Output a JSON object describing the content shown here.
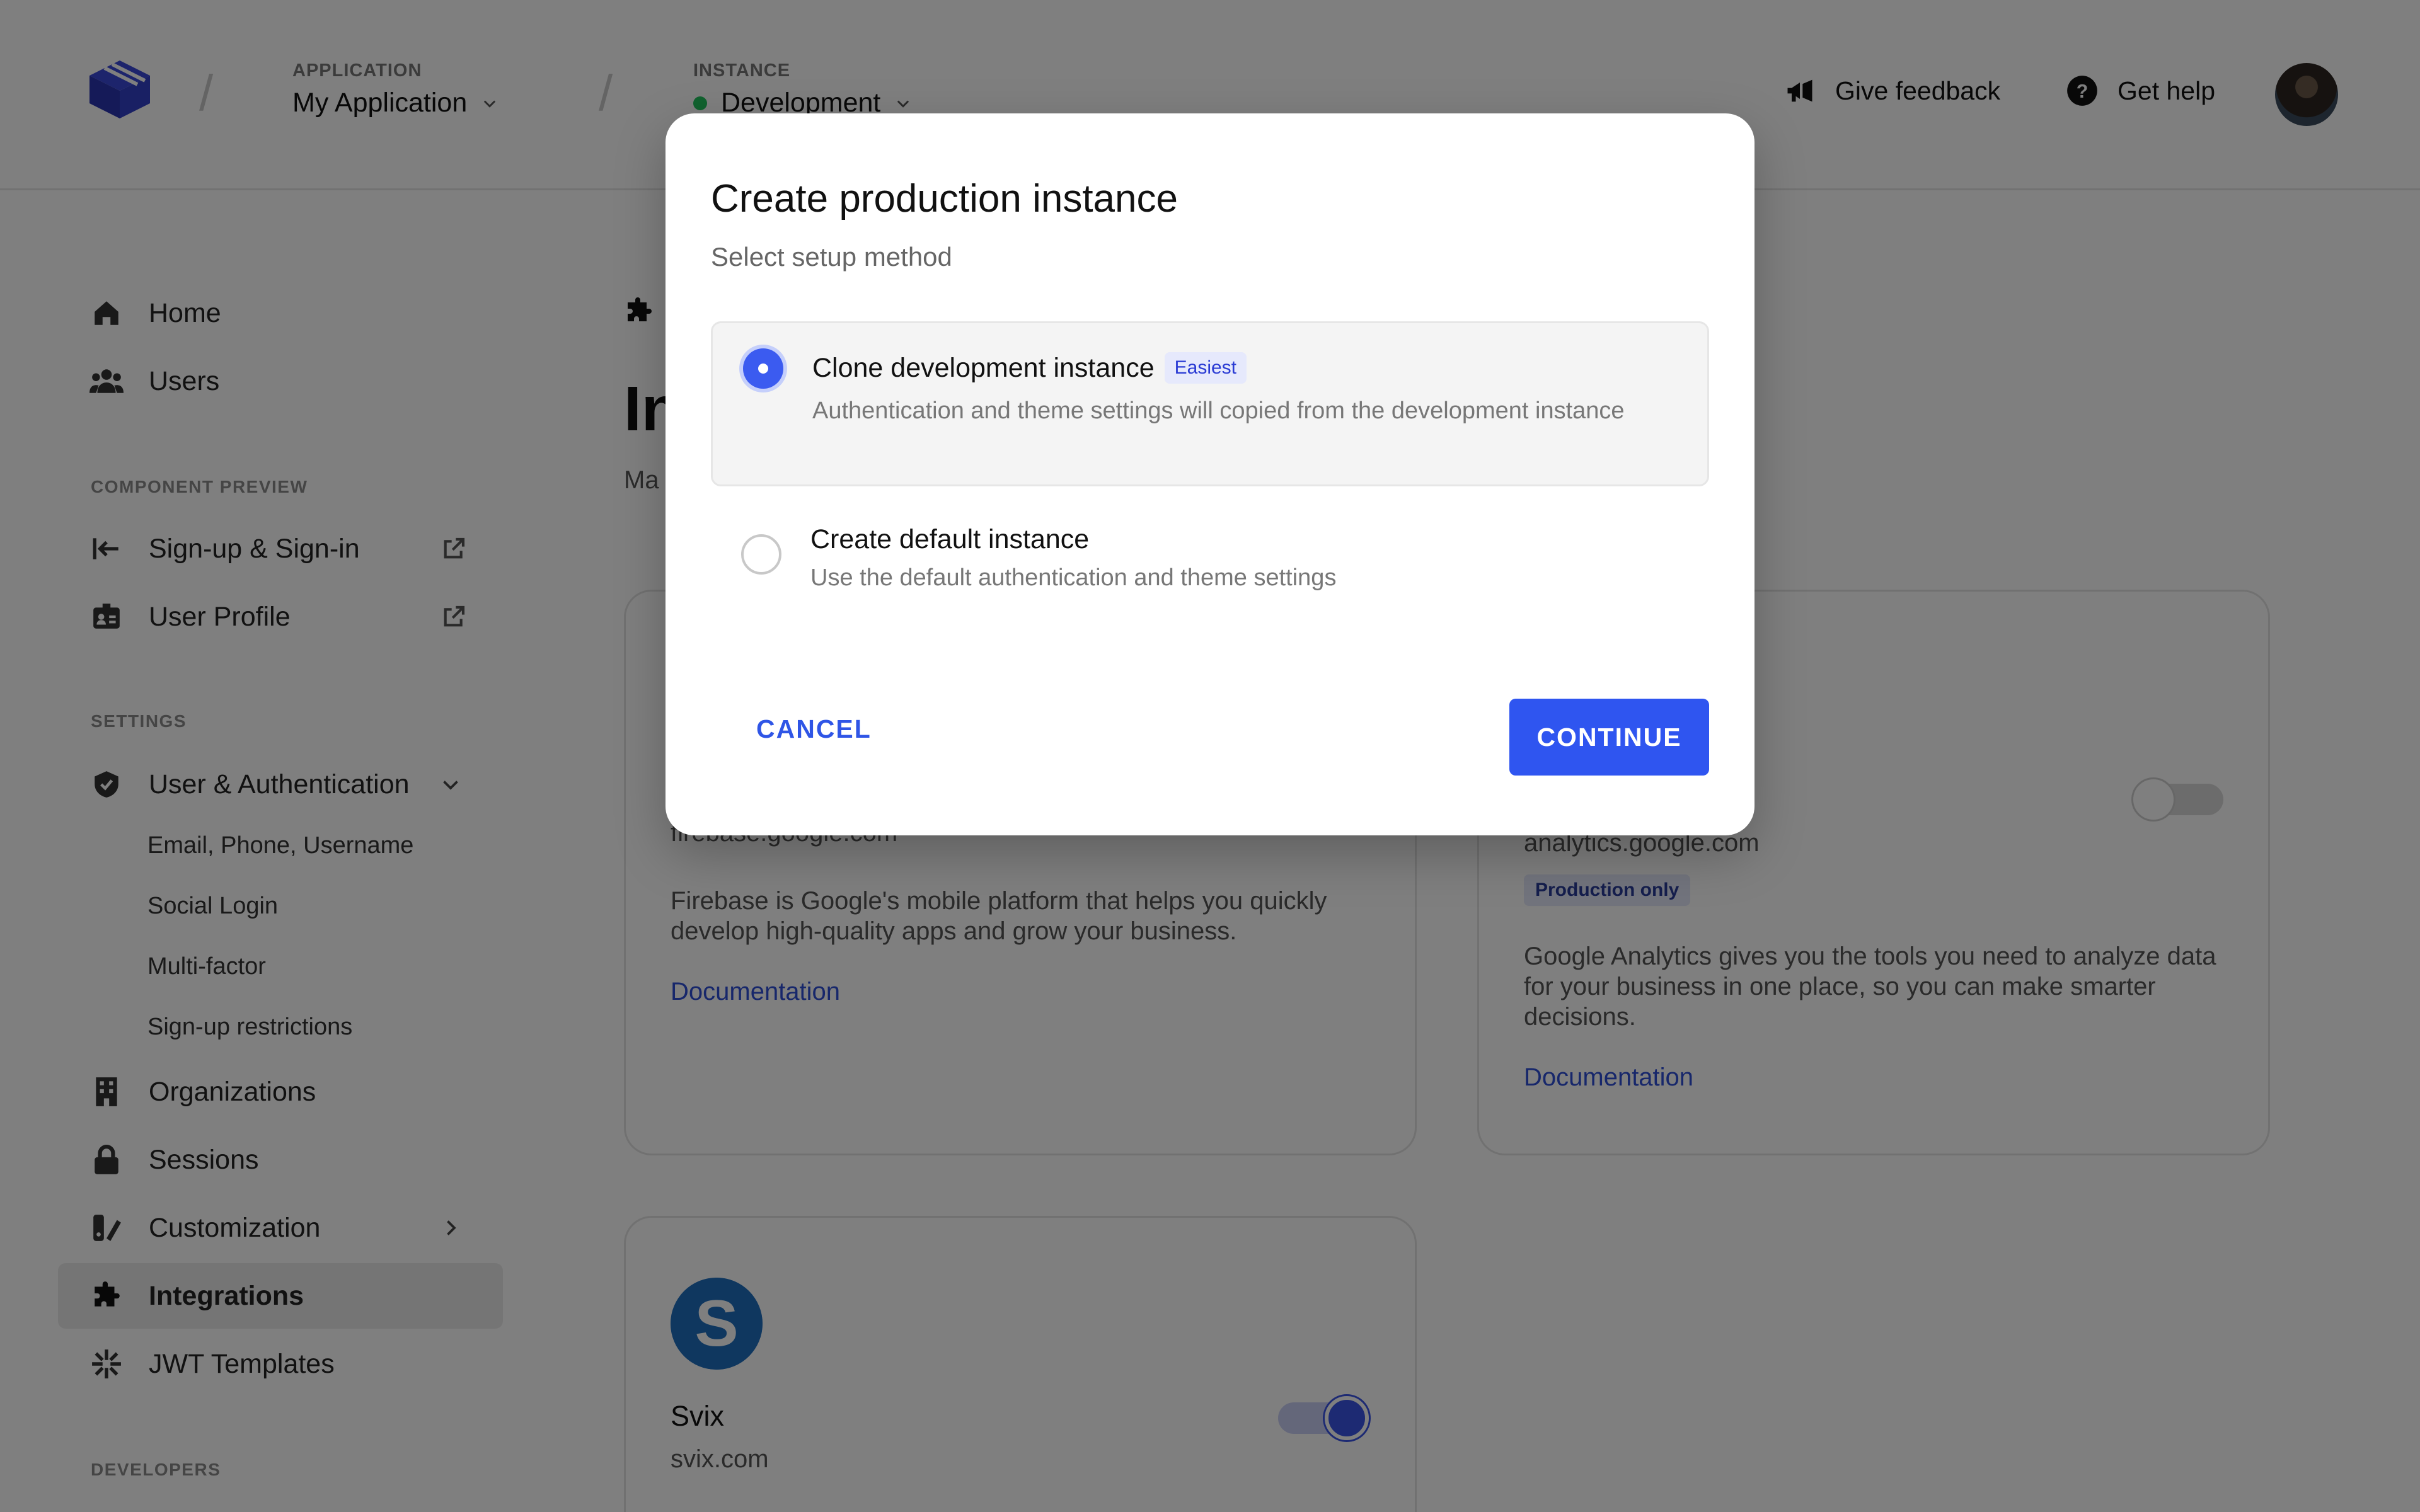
{
  "topbar": {
    "application_label": "APPLICATION",
    "application_value": "My Application",
    "instance_label": "INSTANCE",
    "instance_value": "Development",
    "feedback_label": "Give feedback",
    "help_label": "Get help"
  },
  "sidebar": {
    "home": "Home",
    "users": "Users",
    "component_preview_title": "COMPONENT PREVIEW",
    "signup_signin": "Sign-up & Sign-in",
    "user_profile": "User Profile",
    "settings_title": "SETTINGS",
    "user_auth": "User & Authentication",
    "sub_email": "Email, Phone, Username",
    "sub_social": "Social Login",
    "sub_multifactor": "Multi-factor",
    "sub_signup_restrictions": "Sign-up restrictions",
    "organizations": "Organizations",
    "sessions": "Sessions",
    "customization": "Customization",
    "integrations": "Integrations",
    "jwt_templates": "JWT Templates",
    "developers_title": "DEVELOPERS"
  },
  "main": {
    "title_visible": "In",
    "subtitle_visible": "Ma",
    "firebase": {
      "domain": "firebase.google.com",
      "description": "Firebase is Google's mobile platform that helps you quickly develop high-quality apps and grow your business.",
      "link": "Documentation"
    },
    "analytics": {
      "domain": "analytics.google.com",
      "badge": "Production only",
      "description": "Google Analytics gives you the tools you need to analyze data for your business in one place, so you can make smarter decisions.",
      "link": "Documentation",
      "enabled": false
    },
    "svix": {
      "name": "Svix",
      "domain": "svix.com",
      "enabled": true
    }
  },
  "modal": {
    "title": "Create production instance",
    "subtitle": "Select setup method",
    "option_clone_title": "Clone development instance",
    "option_clone_tag": "Easiest",
    "option_clone_desc": "Authentication and theme settings will copied from the development instance",
    "option_default_title": "Create default instance",
    "option_default_desc": "Use the default authentication and theme settings",
    "cancel_label": "CANCEL",
    "continue_label": "CONTINUE",
    "selected_option": "Clone development instance"
  },
  "colors": {
    "accent": "#2f55f0",
    "link": "#2f4fd6",
    "status_green": "#22c55e"
  }
}
